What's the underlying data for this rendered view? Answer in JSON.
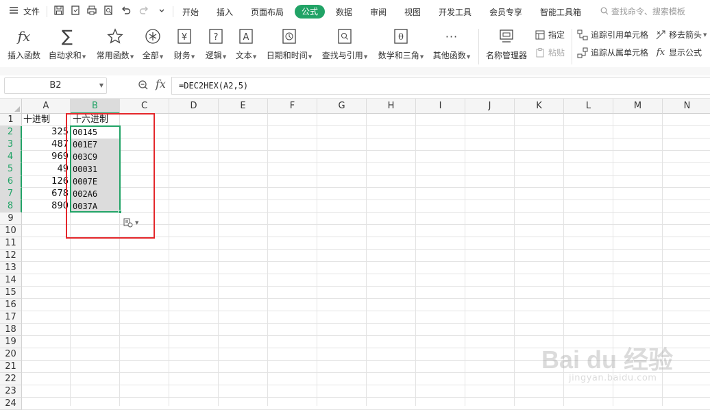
{
  "menubar": {
    "file_label": "文件",
    "tabs": [
      "开始",
      "插入",
      "页面布局",
      "公式",
      "数据",
      "审阅",
      "视图",
      "开发工具",
      "会员专享",
      "智能工具箱"
    ],
    "active_tab": "公式",
    "search_placeholder": "查找命令、搜索模板"
  },
  "ribbon": {
    "insert_function": "插入函数",
    "autosum": "自动求和",
    "common_functions": "常用函数",
    "all": "全部",
    "finance": "财务",
    "logic": "逻辑",
    "text": "文本",
    "datetime": "日期和时间",
    "lookup": "查找与引用",
    "math": "数学和三角",
    "other": "其他函数",
    "name_manager": "名称管理器",
    "specify": "指定",
    "paste": "粘贴",
    "trace_precedents": "追踪引用单元格",
    "trace_dependents": "追踪从属单元格",
    "remove_arrows": "移去箭头",
    "show_formulas": "显示公式"
  },
  "formula_bar": {
    "name_box": "B2",
    "formula": "=DEC2HEX(A2,5)"
  },
  "columns": [
    "A",
    "B",
    "C",
    "D",
    "E",
    "F",
    "G",
    "H",
    "I",
    "J",
    "K",
    "L",
    "M",
    "N"
  ],
  "rows": [
    "1",
    "2",
    "3",
    "4",
    "5",
    "6",
    "7",
    "8",
    "9",
    "10",
    "11",
    "12",
    "13",
    "14",
    "15",
    "16",
    "17",
    "18",
    "19",
    "20",
    "21",
    "22",
    "23",
    "24"
  ],
  "sheet": {
    "header_a": "十进制",
    "header_b": "十六进制",
    "decimal": [
      "325",
      "487",
      "969",
      "49",
      "126",
      "678",
      "890"
    ],
    "hex": [
      "00145",
      "001E7",
      "003C9",
      "00031",
      "0007E",
      "002A6",
      "0037A"
    ]
  },
  "watermark": {
    "brand": "Bai du 经验",
    "site": "jingyan.baidu.com"
  },
  "colors": {
    "accent_green": "#21a366",
    "annotation_red": "#e4262a"
  }
}
